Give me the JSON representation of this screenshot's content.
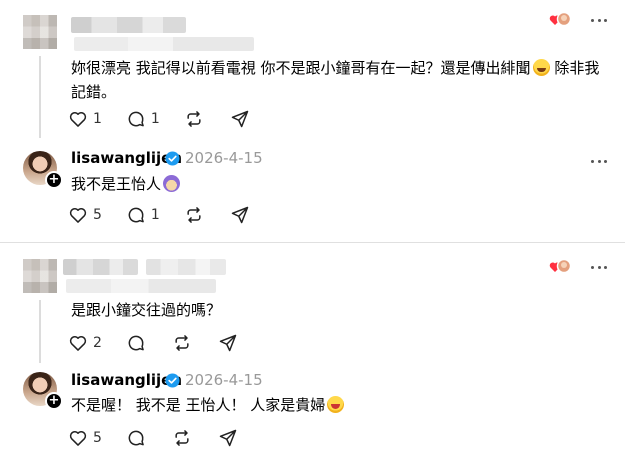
{
  "threads": [
    {
      "comment": {
        "text_line1": "妳很漂亮 我記得以前看電視 你不是跟小鐘哥有在一起？還是傳出緋聞",
        "text_line2": "除非我",
        "text_line3": "記錯。",
        "likes": "1",
        "replies": "1",
        "emoji": "laughing-emoji"
      },
      "reply": {
        "username": "lisawanglijen",
        "date": "2026-4-15",
        "text": "我不是王怡人",
        "likes": "5",
        "replies": "1",
        "emoji": "sheep-emoji"
      }
    },
    {
      "comment": {
        "text_line1": "是跟小鐘交往過的嗎？",
        "likes": "2"
      },
      "reply": {
        "username": "lisawanglijen",
        "date": "2026-4-15",
        "text": "不是喔！ 我不是 王怡人！ 人家是貴婦",
        "likes": "5",
        "emoji": "grinning-emoji"
      }
    }
  ],
  "icons": {
    "like": "heart-outline-icon",
    "reply": "speech-bubble-icon",
    "repost": "repost-icon",
    "share": "send-icon",
    "more": "more-dots-icon",
    "verified": "verified-badge-icon",
    "reaction": "liked-by-author-icon"
  },
  "colors": {
    "verified": "#1d9bf0",
    "reaction_heart": "#ff3040",
    "muted": "#999999"
  }
}
